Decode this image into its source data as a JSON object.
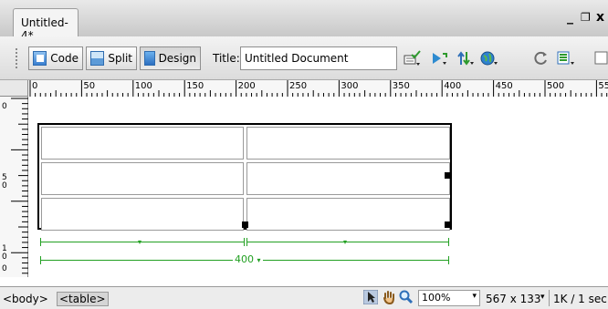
{
  "document_tab": {
    "label": "Untitled-4*"
  },
  "window_controls": {
    "minimize": "_",
    "restore": "❐",
    "close": "x"
  },
  "toolbar": {
    "code_label": "Code",
    "split_label": "Split",
    "design_label": "Design",
    "title_label": "Title:",
    "title_value": "Untitled Document",
    "icons": [
      "validate-icon",
      "browser-check-icon",
      "file-management-icon",
      "preview-globe-icon",
      "refresh-icon",
      "view-options-icon",
      "visual-aids-icon"
    ]
  },
  "ruler": {
    "horizontal_labels": [
      "0",
      "50",
      "100",
      "150",
      "200",
      "250",
      "300",
      "350",
      "400",
      "450",
      "500",
      "55"
    ],
    "vertical_labels": [
      {
        "top": "0",
        "bottom": ""
      },
      {
        "top": "5",
        "bottom": "0"
      },
      {
        "top": "1",
        "bottom": "0"
      },
      {
        "top": "0",
        "bottom": ""
      }
    ]
  },
  "table": {
    "rows": 3,
    "columns": 2,
    "width_label": "400",
    "width_arrow": "▾"
  },
  "status_bar": {
    "tag_body": "<body>",
    "tag_table": "<table>",
    "zoom": "100%",
    "dimensions": "567 x 133",
    "size_info": "1K / 1 sec"
  },
  "colors": {
    "guide_green": "#22a022",
    "accent_blue": "#3a7fd0"
  }
}
